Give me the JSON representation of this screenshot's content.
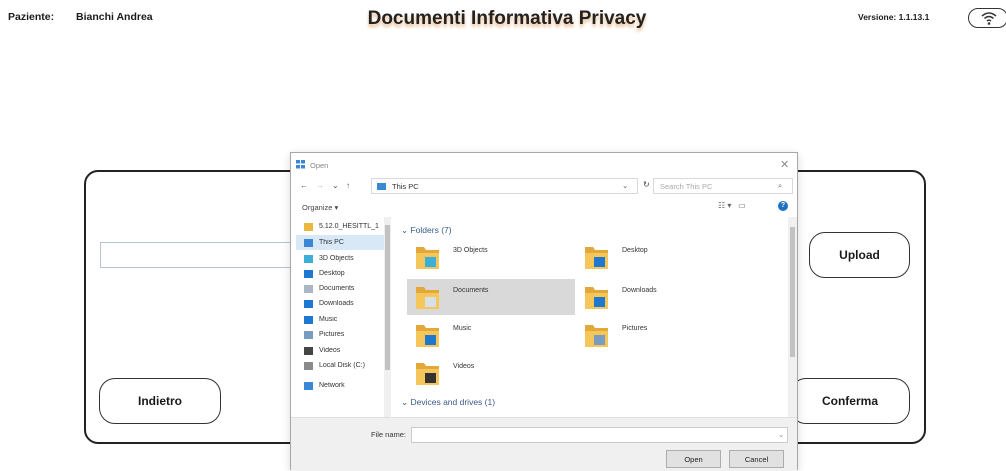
{
  "header": {
    "patient_label": "Paziente:",
    "patient_name": "Bianchi Andrea",
    "title": "Documenti Informativa Privacy",
    "version": "Versione: 1.1.13.1"
  },
  "main": {
    "upload_label": "Upload",
    "back_label": "Indietro",
    "confirm_label": "Conferma"
  },
  "dialog": {
    "title": "Open",
    "address": "This PC",
    "search_placeholder": "Search This PC",
    "organize": "Organize ▾",
    "nav_items": [
      {
        "label": "5.12.0_HESITTL_1",
        "icon": "folder-icon",
        "color": "#e8b93c"
      },
      {
        "label": "This PC",
        "icon": "pc-icon",
        "color": "#3b87d4"
      },
      {
        "label": "3D Objects",
        "icon": "cube-icon",
        "color": "#3ab0d9"
      },
      {
        "label": "Desktop",
        "icon": "desktop-icon",
        "color": "#1e78d0"
      },
      {
        "label": "Documents",
        "icon": "document-icon",
        "color": "#a9b6c4"
      },
      {
        "label": "Downloads",
        "icon": "download-icon",
        "color": "#1e78d0"
      },
      {
        "label": "Music",
        "icon": "music-icon",
        "color": "#1e78d0"
      },
      {
        "label": "Pictures",
        "icon": "picture-icon",
        "color": "#7a9cc0"
      },
      {
        "label": "Videos",
        "icon": "video-icon",
        "color": "#444444"
      },
      {
        "label": "Local Disk (C:)",
        "icon": "disk-icon",
        "color": "#8a8a8a"
      },
      {
        "label": "Network",
        "icon": "network-icon",
        "color": "#3b87d4"
      }
    ],
    "folders_header": "Folders (7)",
    "folders": [
      {
        "label": "3D Objects",
        "badge": "#3ab0d9"
      },
      {
        "label": "Desktop",
        "badge": "#1e78d0"
      },
      {
        "label": "Documents",
        "badge": "#d9dfe6"
      },
      {
        "label": "Downloads",
        "badge": "#1e78d0"
      },
      {
        "label": "Music",
        "badge": "#1e78d0"
      },
      {
        "label": "Pictures",
        "badge": "#7a9cc0"
      },
      {
        "label": "Videos",
        "badge": "#333333"
      }
    ],
    "devices_header": "Devices and drives (1)",
    "filename_label": "File name:",
    "filename_value": "",
    "open_label": "Open",
    "cancel_label": "Cancel"
  },
  "colors": {
    "folder_yellow": "#f5c75a",
    "folder_dark": "#e2a93a",
    "selection": "#d9e8f7"
  }
}
